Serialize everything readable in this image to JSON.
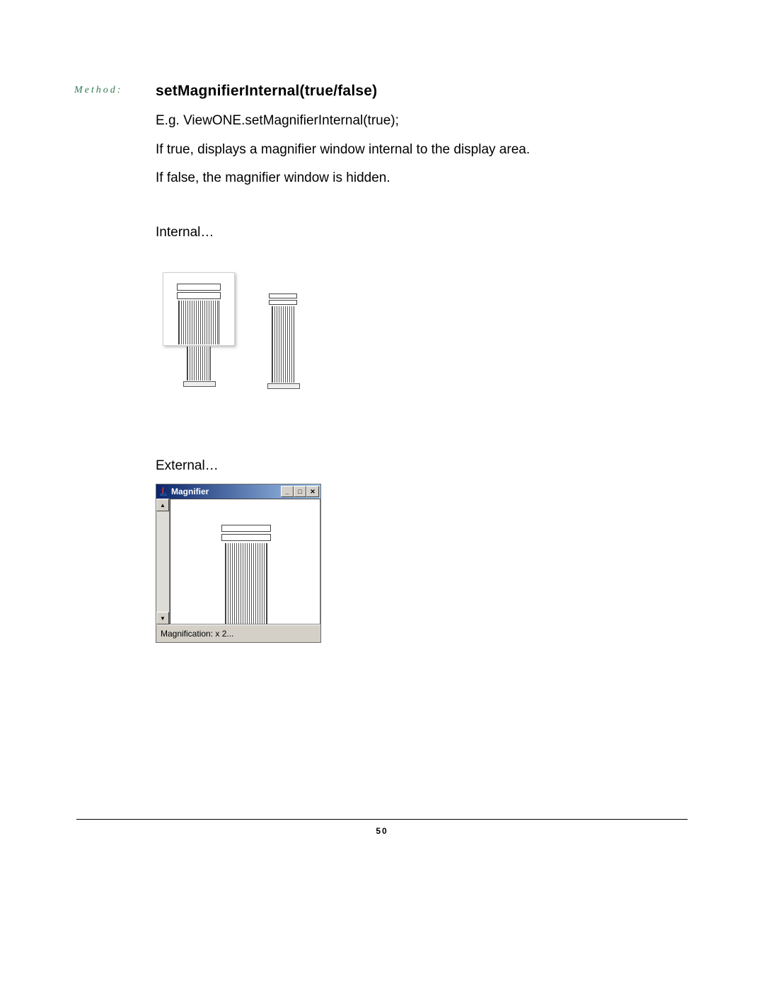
{
  "label": "Method:",
  "heading": "setMagnifierInternal(true/false)",
  "paragraphs": {
    "example": "E.g. ViewONE.setMagnifierInternal(true);",
    "true_desc": "If true, displays a magnifier window internal to the display area.",
    "false_desc": "If false, the magnifier window is hidden.",
    "internal_label": "Internal…",
    "external_label": "External…"
  },
  "magnifier_window": {
    "title": "Magnifier",
    "min_glyph": "_",
    "max_glyph": "□",
    "close_glyph": "✕",
    "scroll_up_glyph": "▲",
    "scroll_down_glyph": "▼",
    "status": "Magnification: x 2..."
  },
  "page_number": "50"
}
